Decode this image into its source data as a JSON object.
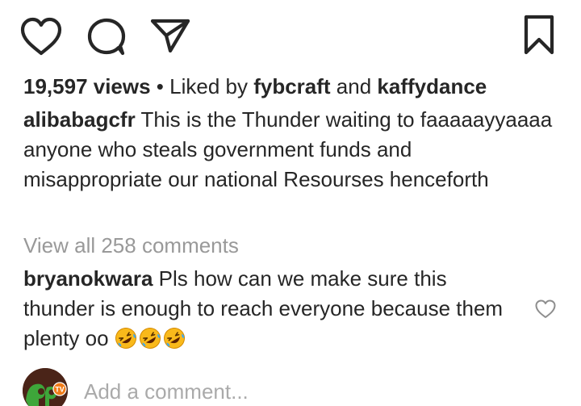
{
  "post": {
    "views": "19,597 views",
    "separator": " • ",
    "liked_by_prefix": "Liked by ",
    "liked_by_user1": "fybcraft",
    "liked_by_and": " and ",
    "liked_by_user2": "kaffydance",
    "caption_author": "alibabagcfr",
    "caption_text": "This is the Thunder waiting to faaaaayyaaaa anyone who steals government funds and misappropriate our national Resourses henceforth",
    "view_all_comments": "View all 258 comments"
  },
  "comments": [
    {
      "author": "bryanokwara",
      "text": "Pls how can we make sure this thunder is enough to reach everyone because them plenty oo",
      "emoji": [
        "rolling-on-floor-laughing",
        "rolling-on-floor-laughing",
        "rolling-on-floor-laughing"
      ]
    }
  ],
  "composer": {
    "placeholder": "Add a comment...",
    "avatar_badge": "TV"
  },
  "colors": {
    "text": "#262626",
    "muted": "#999999",
    "placeholder": "#aaaaaa",
    "emoji_yellow": "#f9b91b",
    "emoji_tear": "#3da8f3",
    "avatar_green": "#3ea63a",
    "avatar_orange": "#f07b18"
  },
  "icons": {
    "like": "heart-outline-icon",
    "comment": "speech-bubble-icon",
    "share": "paper-plane-icon",
    "save": "bookmark-icon",
    "comment_like": "small-heart-icon"
  }
}
